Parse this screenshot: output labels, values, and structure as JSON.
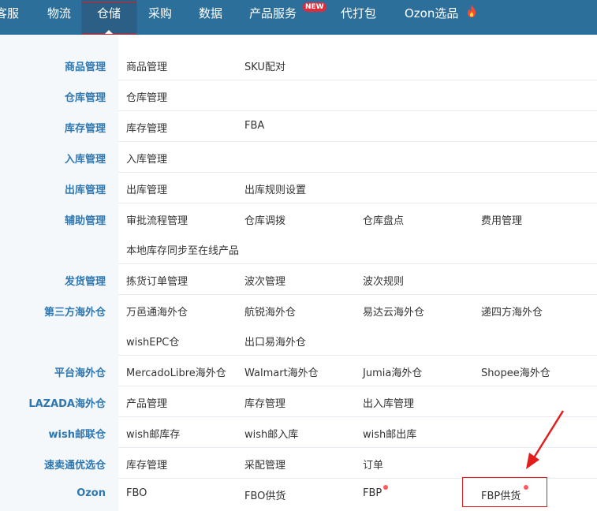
{
  "nav": {
    "items": [
      "客服",
      "物流",
      "仓储",
      "采购",
      "数据",
      "产品服务",
      "代打包",
      "Ozon选品"
    ],
    "new_badge": "NEW"
  },
  "categories": {
    "goods": "商品管理",
    "warehouse": "仓库管理",
    "inventory": "库存管理",
    "inbound": "入库管理",
    "outbound": "出库管理",
    "auxiliary": "辅助管理",
    "shipping": "发货管理",
    "third_party": "第三方海外仓",
    "platform": "平台海外仓",
    "lazada": "LAZADA海外仓",
    "wish": "wish邮联仓",
    "speedsell": "速卖通优选仓",
    "ozon": "Ozon"
  },
  "items": {
    "goods": [
      "商品管理",
      "SKU配对"
    ],
    "warehouse": [
      "仓库管理"
    ],
    "inventory": [
      "库存管理",
      "FBA"
    ],
    "inbound": [
      "入库管理"
    ],
    "outbound": [
      "出库管理",
      "出库规则设置"
    ],
    "auxiliary": [
      "审批流程管理",
      "仓库调拨",
      "仓库盘点",
      "费用管理",
      "本地库存同步至在线产品"
    ],
    "shipping": [
      "拣货订单管理",
      "波次管理",
      "波次规则"
    ],
    "third_party": [
      "万邑通海外仓",
      "航锐海外仓",
      "易达云海外仓",
      "递四方海外仓",
      "wishEPC仓",
      "出口易海外仓"
    ],
    "platform": [
      "MercadoLibre海外仓",
      "Walmart海外仓",
      "Jumia海外仓",
      "Shopee海外仓"
    ],
    "lazada": [
      "产品管理",
      "库存管理",
      "出入库管理"
    ],
    "wish": [
      "wish邮库存",
      "wish邮入库",
      "wish邮出库"
    ],
    "speedsell": [
      "库存管理",
      "采配管理",
      "订单"
    ],
    "ozon": [
      "FBO",
      "FBO供货",
      "FBP",
      "FBP供货"
    ]
  },
  "colors": {
    "nav_bg": "#2c6f9a",
    "nav_active_bg": "#2b5f86",
    "category_text": "#2f77b0",
    "highlight": "#e21d1d",
    "new_dot": "#ff5a5f"
  },
  "icons": [
    "fire-icon",
    "red-arrow-annotation"
  ]
}
